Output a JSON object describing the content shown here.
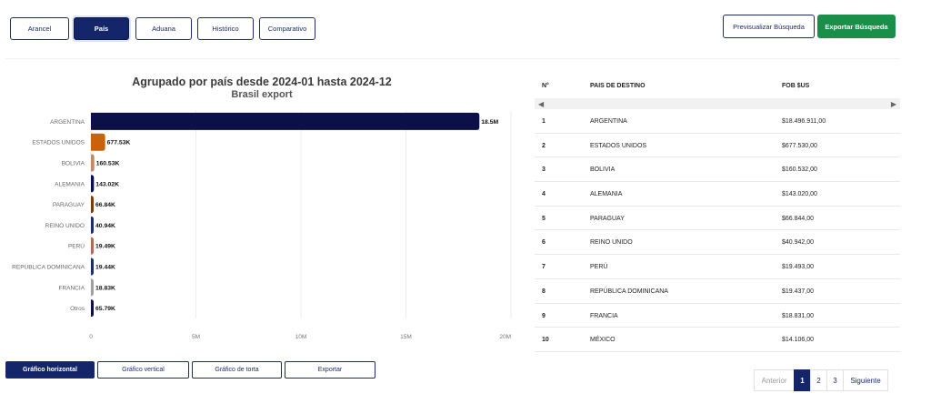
{
  "tabs": [
    {
      "label": "Arancel",
      "active": false
    },
    {
      "label": "País",
      "active": true
    },
    {
      "label": "Aduana",
      "active": false
    },
    {
      "label": "Histórico",
      "active": false
    },
    {
      "label": "Comparativo",
      "active": false
    }
  ],
  "actions": {
    "preview_label": "Previsualizar Búsqueda",
    "export_label": "Exportar Búsqueda"
  },
  "colors": {
    "navy": "#15256a",
    "green": "#198f4a"
  },
  "chart_data": {
    "type": "bar",
    "orientation": "horizontal",
    "title": "Agrupado por país desde 2024-01 hasta 2024-12",
    "subtitle": "Brasil export",
    "categories": [
      "ARGENTINA",
      "ESTADOS UNIDOS",
      "BOLIVIA",
      "ALEMANIA",
      "PARAGUAY",
      "REINO UNIDO",
      "PERÚ",
      "REPÚBLICA DOMINICANA",
      "FRANCIA",
      "Otros"
    ],
    "values": [
      18496911,
      677530,
      160532,
      143020,
      66844,
      40942,
      19493,
      19437,
      18831,
      65790
    ],
    "data_labels": [
      "18.5M",
      "677.53K",
      "160.53K",
      "143.02K",
      "66.84K",
      "40.94K",
      "19.49K",
      "19.44K",
      "18.83K",
      "65.79K"
    ],
    "colors": [
      "#0b1148",
      "#c8620c",
      "#c08a66",
      "#0b1148",
      "#7a3c0d",
      "#1d2d66",
      "#b06a58",
      "#1d2d66",
      "#a0a0a0",
      "#0b1148"
    ],
    "xlim": [
      0,
      20000000
    ],
    "xticks": [
      "0",
      "5M",
      "10M",
      "15M",
      "20M"
    ],
    "grid": true
  },
  "chart_buttons": [
    {
      "label": "Gráfico horizontal",
      "active": true
    },
    {
      "label": "Gráfico vertical",
      "active": false
    },
    {
      "label": "Gráfico de torta",
      "active": false
    },
    {
      "label": "Exportar",
      "active": false
    }
  ],
  "table": {
    "headers": [
      "N°",
      "PAIS DE DESTINO",
      "FOB $US"
    ],
    "rows": [
      {
        "n": "1",
        "country": "ARGENTINA",
        "fob": "$18.496.911,00"
      },
      {
        "n": "2",
        "country": "ESTADOS UNIDOS",
        "fob": "$677.530,00"
      },
      {
        "n": "3",
        "country": "BOLIVIA",
        "fob": "$160.532,00"
      },
      {
        "n": "4",
        "country": "ALEMANIA",
        "fob": "$143.020,00"
      },
      {
        "n": "5",
        "country": "PARAGUAY",
        "fob": "$66.844,00"
      },
      {
        "n": "6",
        "country": "REINO UNIDO",
        "fob": "$40.942,00"
      },
      {
        "n": "7",
        "country": "PERÚ",
        "fob": "$19.493,00"
      },
      {
        "n": "8",
        "country": "REPÚBLICA DOMINICANA",
        "fob": "$19.437,00"
      },
      {
        "n": "9",
        "country": "FRANCIA",
        "fob": "$18.831,00"
      },
      {
        "n": "10",
        "country": "MÉXICO",
        "fob": "$14.106,00"
      }
    ]
  },
  "pagination": {
    "prev_label": "Anterior",
    "pages": [
      "1",
      "2",
      "3"
    ],
    "current": "1",
    "next_label": "Siguiente"
  }
}
